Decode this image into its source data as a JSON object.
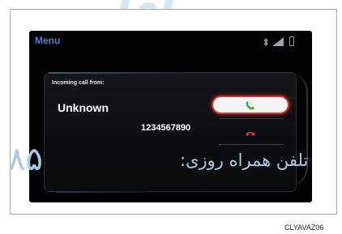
{
  "screen": {
    "menu_label": "Menu"
  },
  "call": {
    "incoming_label": "Incoming call from:",
    "caller_name": "Unknown",
    "caller_number": "1234567890"
  },
  "watermark": {
    "line1": "تلفن همراه روزی:",
    "line1_digits": "۸۵"
  },
  "image_code": "CLYAVAZ06",
  "colors": {
    "accent_menu": "#5a7cc4",
    "answer_icon": "#3aa83a",
    "decline_icon": "#e03a3a",
    "answer_glow": "#c43a2c"
  },
  "icons": {
    "bluetooth": "bluetooth-icon",
    "signal": "signal-strength-icon",
    "battery": "battery-icon",
    "answer": "phone-answer-icon",
    "decline": "phone-decline-icon"
  }
}
